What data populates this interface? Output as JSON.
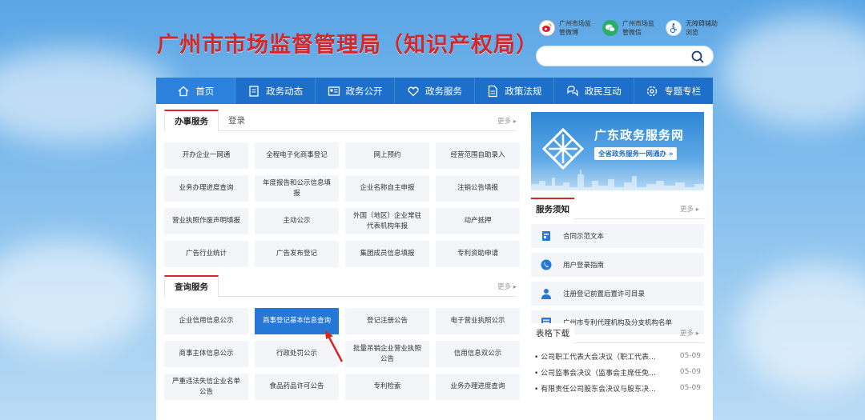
{
  "header": {
    "title": "广州市市场监督管理局（知识产权局）",
    "social": [
      {
        "label": "广州市场监管微博",
        "icon": "weibo-icon",
        "color": "#e6162d"
      },
      {
        "label": "广州市场监管微信",
        "icon": "wechat-icon",
        "color": "#2aae67"
      },
      {
        "label": "无障碍辅助浏览",
        "icon": "accessibility-icon",
        "color": "#1e6fc9"
      }
    ],
    "search": {
      "placeholder": ""
    }
  },
  "nav": [
    {
      "label": "首页",
      "icon": "home-icon"
    },
    {
      "label": "政务动态",
      "icon": "document-icon"
    },
    {
      "label": "政务公开",
      "icon": "info-card-icon"
    },
    {
      "label": "政务服务",
      "icon": "heart-icon"
    },
    {
      "label": "政策法规",
      "icon": "file-icon"
    },
    {
      "label": "政民互动",
      "icon": "interaction-icon"
    },
    {
      "label": "专题专栏",
      "icon": "gear-icon"
    }
  ],
  "office_services": {
    "tabs": [
      "办事服务",
      "登录"
    ],
    "more": "更多 ▸",
    "items": [
      "开办企业一网通",
      "全程电子化商事登记",
      "网上预约",
      "经营范围自助录入",
      "业务办理进度查询",
      "年度报告和公示信息填报",
      "企业名称自主申报",
      "注销公告填报",
      "营业执照作废声明填报",
      "主动公示",
      "外国（地区）企业常驻代表机构年报",
      "动产抵押",
      "广告行业统计",
      "广告发布登记",
      "集团成员信息填报",
      "专利资助申请"
    ]
  },
  "query_services": {
    "tabs": [
      "查询服务"
    ],
    "more": "更多 ▸",
    "items": [
      "企业信用信息公示",
      "商事登记基本信息查询",
      "登记注册公告",
      "电子营业执照公示",
      "商事主体信息公示",
      "行政处罚公示",
      "批量吊销企业营业执照公告",
      "信用信息双公示",
      "严重违法失信企业名单公告",
      "食品药品许可公告",
      "专利检索",
      "业务办理进度查询"
    ]
  },
  "banner": {
    "title": "广东政务服务网",
    "subtitle": "全省政务服务一网通办 »"
  },
  "service_notice": {
    "title": "服务须知",
    "more": "更多 ▸",
    "items": [
      {
        "label": "合同示范文本",
        "icon": "contract-icon"
      },
      {
        "label": "用户登录指南",
        "icon": "phone-icon"
      },
      {
        "label": "注册登记前置后置许可目录",
        "icon": "user-icon"
      },
      {
        "label": "广州市专利代理机构及分支机构名单",
        "icon": "list-icon"
      }
    ]
  },
  "downloads": {
    "title": "表格下载",
    "more": "更多 ▸",
    "items": [
      {
        "label": "• 公司职工代表大会决议（职工代表...",
        "date": "05-09"
      },
      {
        "label": "• 公司监事会决议（监事会主席任免...",
        "date": "05-09"
      },
      {
        "label": "• 有限责任公司股东会决议与股东决...",
        "date": "05-09"
      }
    ]
  },
  "colors": {
    "brand_red": "#d2282a",
    "nav_blue": "#1e6fc9",
    "active_blue": "#2578d6"
  }
}
